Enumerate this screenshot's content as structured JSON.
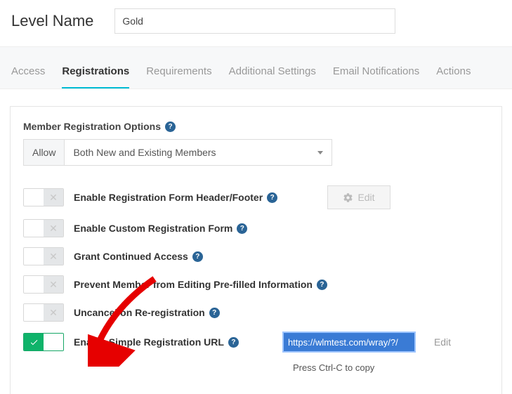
{
  "header": {
    "label": "Level Name",
    "value": "Gold"
  },
  "tabs": [
    {
      "label": "Access",
      "active": false
    },
    {
      "label": "Registrations",
      "active": true
    },
    {
      "label": "Requirements",
      "active": false
    },
    {
      "label": "Additional Settings",
      "active": false
    },
    {
      "label": "Email Notifications",
      "active": false
    },
    {
      "label": "Actions",
      "active": false
    }
  ],
  "section": {
    "title": "Member Registration Options",
    "allow_label": "Allow",
    "allow_value": "Both New and Existing Members"
  },
  "options": [
    {
      "label": "Enable Registration Form Header/Footer",
      "on": false,
      "edit": true
    },
    {
      "label": "Enable Custom Registration Form",
      "on": false
    },
    {
      "label": "Grant Continued Access",
      "on": false
    },
    {
      "label": "Prevent Member from Editing Pre-filled Information",
      "on": false
    },
    {
      "label": "Uncancel on Re-registration",
      "on": false
    },
    {
      "label": "Enable Simple Registration URL",
      "on": true,
      "url": "https://wlmtest.com/wray/?/"
    }
  ],
  "edit_button": "Edit",
  "edit_link": "Edit",
  "copy_hint": "Press Ctrl-C to copy"
}
